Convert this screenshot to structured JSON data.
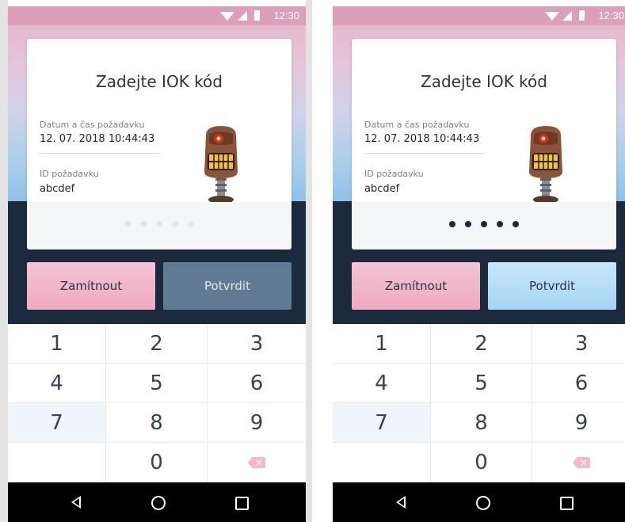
{
  "status_bar": {
    "time": "12:30"
  },
  "card": {
    "title": "Zadejte IOK kód",
    "request_datetime_label": "Datum a čas požadavku",
    "request_datetime_value": "12. 07. 2018 10:44:43",
    "request_id_label": "ID požadavku",
    "request_id_value": "abcdef"
  },
  "pin": {
    "length": 5,
    "left_filled": 0,
    "right_filled": 5,
    "empty_color": "#e3e6eb",
    "filled_color": "#1c2a3d"
  },
  "buttons": {
    "reject_label": "Zamítnout",
    "confirm_label": "Potvrdit",
    "left_confirm_state": "disabled",
    "right_confirm_state": "enabled"
  },
  "keypad": {
    "keys": [
      "1",
      "2",
      "3",
      "4",
      "5",
      "6",
      "7",
      "8",
      "9",
      "",
      "0",
      "backspace-icon"
    ],
    "pressed_key": "7"
  },
  "navbar": {
    "icons": [
      "back-icon",
      "home-icon",
      "recents-icon"
    ]
  },
  "colors": {
    "accent_pink": "#f0a9c1",
    "accent_blue": "#a6d4f3",
    "dark_panel": "#1c2a3d",
    "disabled_button": "#5f7a92"
  }
}
